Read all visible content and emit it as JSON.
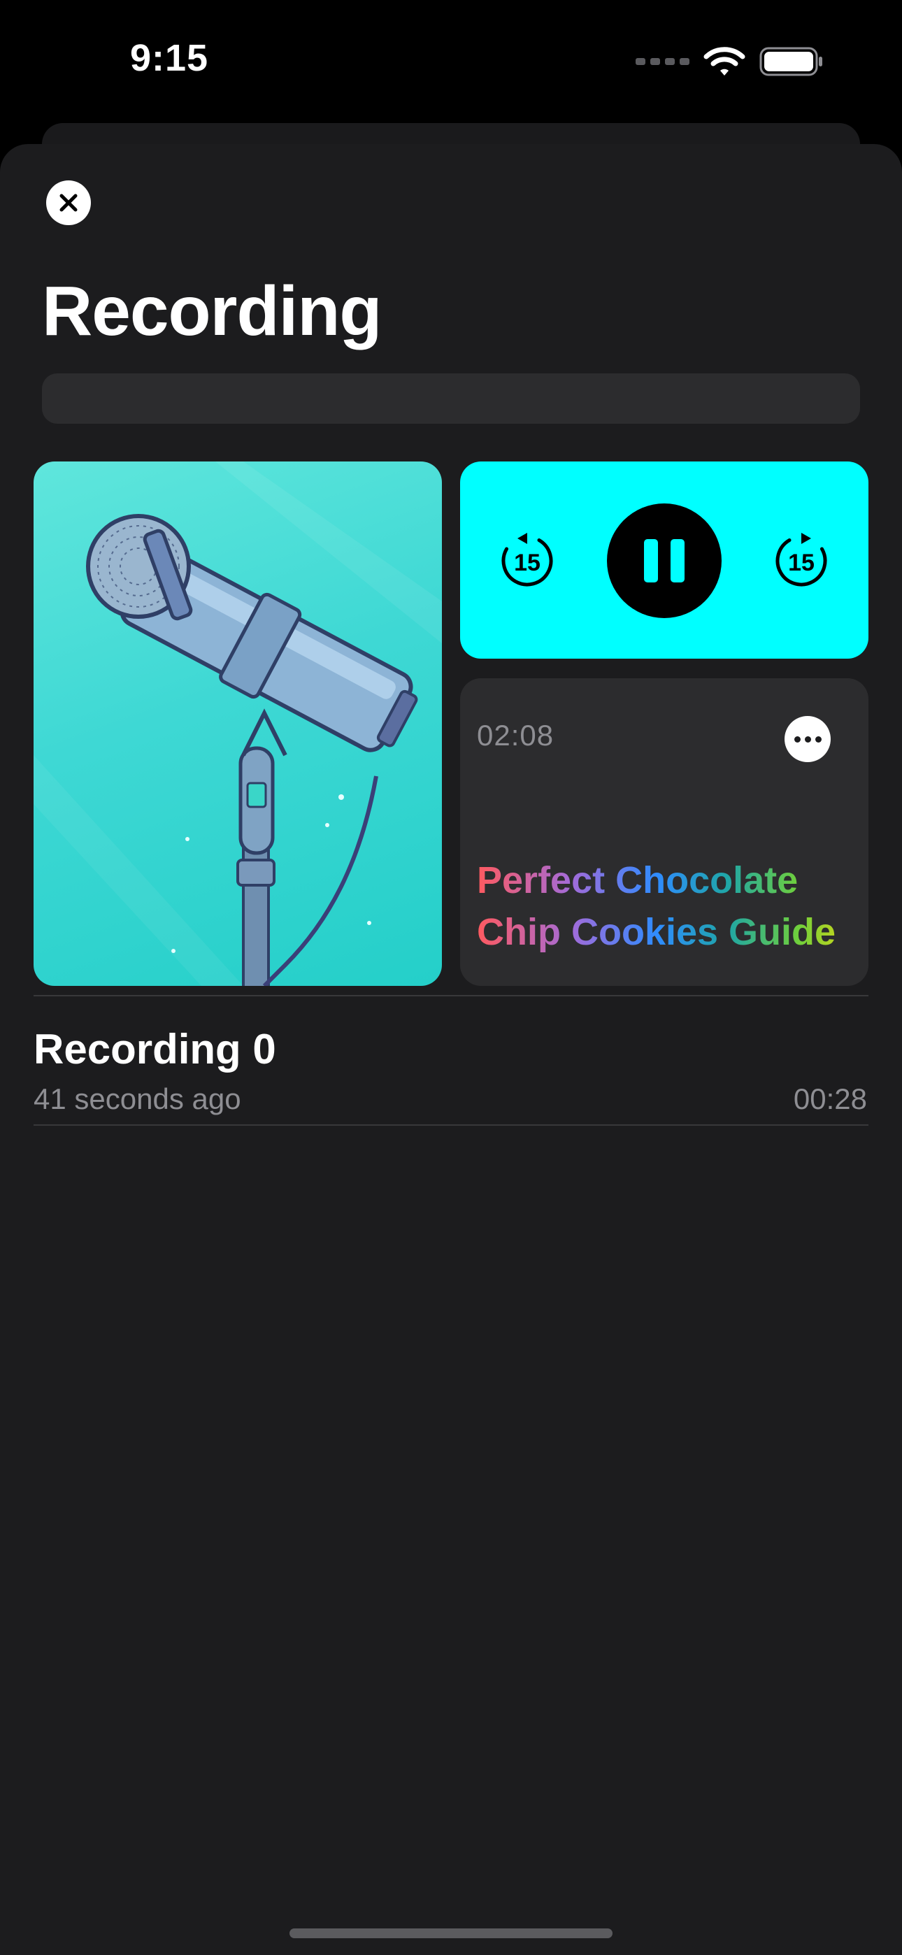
{
  "status_bar": {
    "time": "9:15",
    "icons": [
      "cellular-signal-icon",
      "wifi-icon",
      "battery-icon"
    ]
  },
  "header": {
    "close_icon": "close-icon",
    "title": "Recording"
  },
  "player": {
    "artwork": "microphone-illustration",
    "skip_back_label": "15",
    "skip_forward_label": "15",
    "play_state": "pause-icon",
    "accent_color": "#00ffff",
    "elapsed_time": "02:08",
    "more_icon": "ellipsis-icon",
    "episode_title": "Perfect Chocolate Chip Cookies Guide"
  },
  "recordings": [
    {
      "title": "Recording 0",
      "subtitle": "41 seconds ago",
      "duration": "00:28"
    }
  ]
}
